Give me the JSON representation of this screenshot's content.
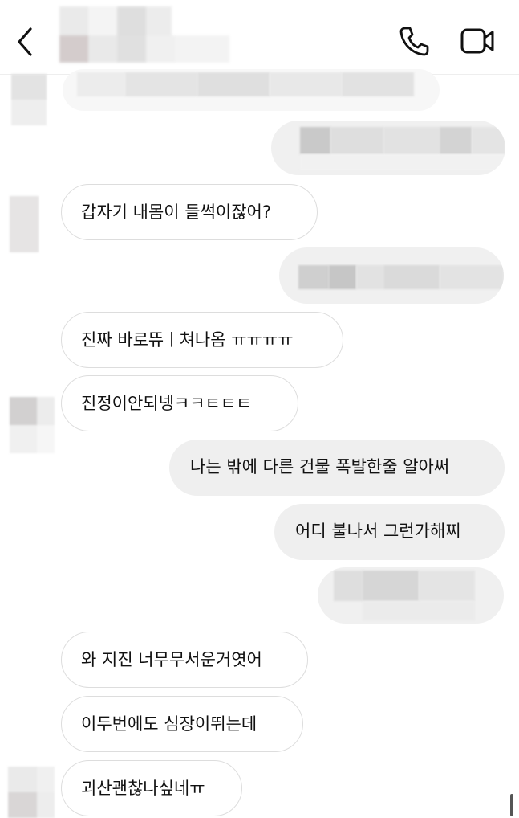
{
  "header": {
    "back_icon": "chevron-left-icon",
    "call_icon": "phone-icon",
    "video_icon": "video-camera-icon"
  },
  "messages": [
    {
      "side": "received",
      "text": "갑자기 내몸이 들썩이잖어?"
    },
    {
      "side": "received",
      "text": "진짜 바로뜌ㅣ쳐나옴 ㅠㅠㅠㅠ"
    },
    {
      "side": "received",
      "text": "진정이안되넹ㅋㅋㅌㅌㅌ"
    },
    {
      "side": "sent",
      "text": "나는 밖에 다른 건물 폭발한줄 알아써"
    },
    {
      "side": "sent",
      "text": "어디 불나서 그런가해찌"
    },
    {
      "side": "received",
      "text": "와 지진 너무무서운거엿어"
    },
    {
      "side": "received",
      "text": "이두번에도 심장이뛰는데"
    },
    {
      "side": "received",
      "text": "괴산괜찮나싶네ㅠ"
    }
  ]
}
